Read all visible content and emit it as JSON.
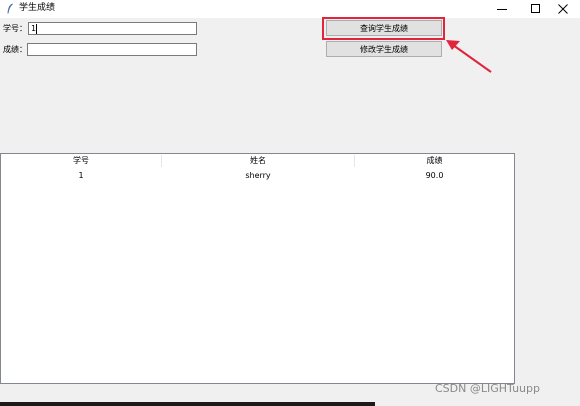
{
  "window": {
    "title": "学生成绩",
    "icon": "feather-icon",
    "controls": [
      "minimize-icon",
      "maximize-icon",
      "close-icon"
    ]
  },
  "form": {
    "student_id_label": "学号：",
    "student_id_value": "1",
    "score_label": "成绩：",
    "score_value": ""
  },
  "buttons": {
    "query_label": "查询学生成绩",
    "modify_label": "修改学生成绩"
  },
  "annotation": {
    "highlight_color": "#e0253c"
  },
  "table": {
    "columns": [
      "学号",
      "姓名",
      "成绩"
    ],
    "rows": [
      [
        "1",
        "sherry",
        "90.0"
      ]
    ]
  },
  "watermark": "CSDN @LIGHTuupp"
}
